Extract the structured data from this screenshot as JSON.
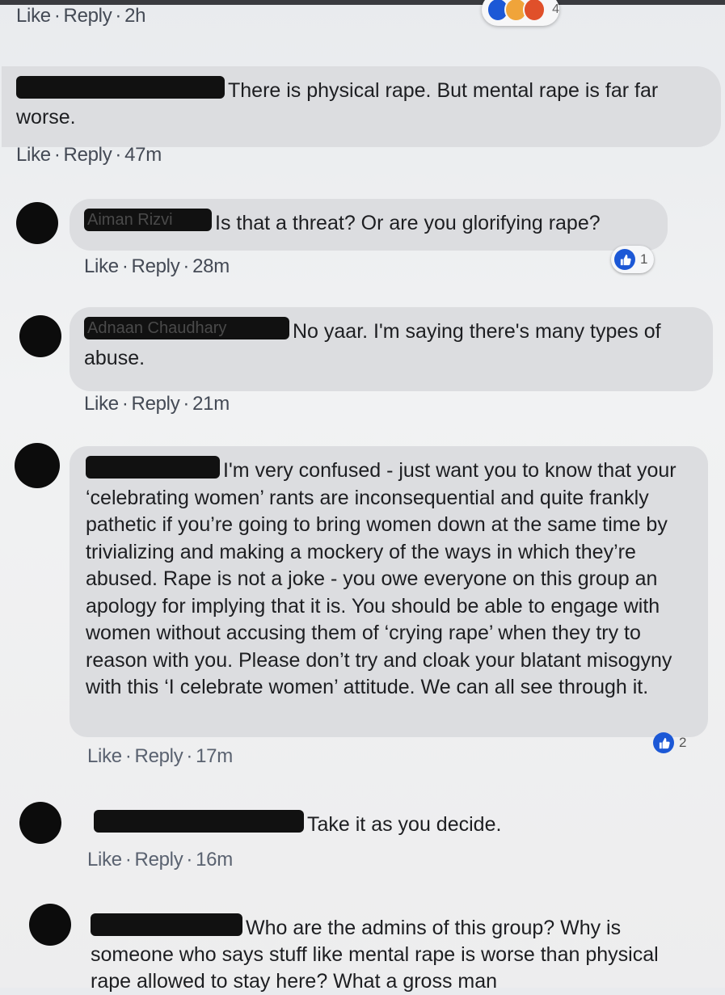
{
  "comments": [
    {
      "actions": {
        "like": "Like",
        "reply": "Reply",
        "time": "2h"
      },
      "top_reaction_count": "4"
    },
    {
      "author": "",
      "text": "There is physical rape. But mental rape is far far worse.",
      "actions": {
        "like": "Like",
        "reply": "Reply",
        "time": "47m"
      }
    },
    {
      "author": "Aiman Rizvi",
      "text": "Is that a threat? Or are you glorifying rape?",
      "actions": {
        "like": "Like",
        "reply": "Reply",
        "time": "28m"
      },
      "reactions": "1"
    },
    {
      "author": "Adnaan Chaudhary",
      "text": "No yaar. I'm saying there's many types of abuse.",
      "actions": {
        "like": "Like",
        "reply": "Reply",
        "time": "21m"
      }
    },
    {
      "author": "",
      "text": "I'm very confused - just want you to know that your ‘celebrating women’ rants are inconsequential and quite frankly pathetic if you’re going to bring women down at the same time by trivializing and making a mockery of the ways in which they’re abused. Rape is not a joke - you owe everyone on this group an apology for implying that it is. You should be able to engage with women without accusing them of ‘crying rape’ when they try to reason with you. Please don’t try and cloak your blatant misogyny with this ‘I celebrate women’ attitude. We can all see through it.",
      "actions": {
        "like": "Like",
        "reply": "Reply",
        "time": "17m"
      },
      "reactions": "2"
    },
    {
      "author": "",
      "text": "Take it as you decide.",
      "actions": {
        "like": "Like",
        "reply": "Reply",
        "time": "16m"
      }
    },
    {
      "author": "",
      "text": "Who are the admins of this group? Why is someone who says stuff like mental rape is worse than physical rape allowed to stay here? What a gross man"
    }
  ],
  "icons": {
    "like": "thumbs-up-icon",
    "avatar": "avatar"
  },
  "colors": {
    "like_blue": "#1c58d6",
    "bubble": "#dcdde0",
    "redaction": "#111111"
  }
}
